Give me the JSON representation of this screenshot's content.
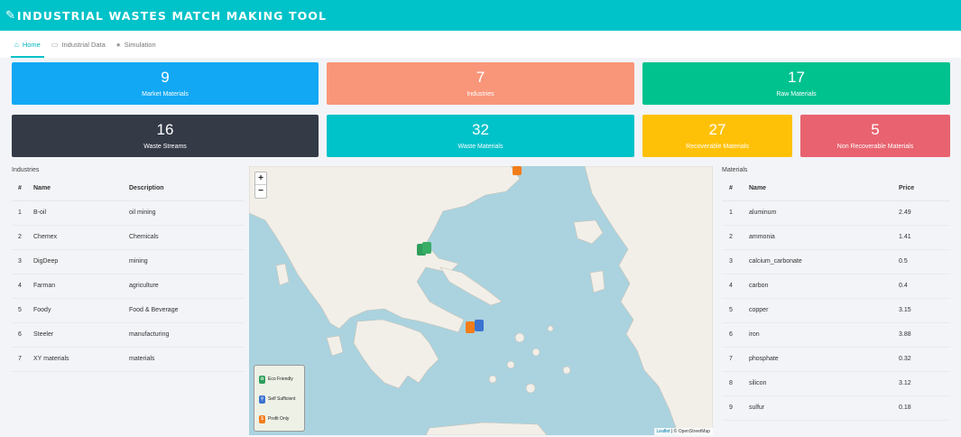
{
  "app": {
    "title": "INDUSTRIAL WASTES MATCH MAKING TOOL",
    "logo_icon": "pencil-square-icon"
  },
  "nav": {
    "tabs": [
      {
        "label": "Home",
        "icon": "home-icon",
        "active": true
      },
      {
        "label": "Industrial Data",
        "icon": "folder-icon",
        "active": false
      },
      {
        "label": "Simulation",
        "icon": "android-icon",
        "active": false
      }
    ]
  },
  "stats": [
    {
      "value": "9",
      "label": "Market Materials",
      "color": "#12a8f4"
    },
    {
      "value": "7",
      "label": "Industries",
      "color": "#f9967a"
    },
    {
      "value": "17",
      "label": "Raw Materials",
      "color": "#00c28f"
    },
    {
      "value": "16",
      "label": "Waste Streams",
      "color": "#343a46"
    },
    {
      "value": "32",
      "label": "Waste Materials",
      "color": "#00c2c9"
    },
    {
      "value": "27",
      "label": "Recoverable Materials",
      "color": "#ffc107"
    },
    {
      "value": "5",
      "label": "Non Recoverable Materials",
      "color": "#e8636f"
    }
  ],
  "industries": {
    "title": "Industries",
    "columns": [
      "#",
      "Name",
      "Description"
    ],
    "rows": [
      [
        "1",
        "B-oil",
        "oil mining"
      ],
      [
        "2",
        "Chemex",
        "Chemicals"
      ],
      [
        "3",
        "DigDeep",
        "mining"
      ],
      [
        "4",
        "Farman",
        "agriculture"
      ],
      [
        "5",
        "Foody",
        "Food & Beverage"
      ],
      [
        "6",
        "Steeler",
        "manufacturing"
      ],
      [
        "7",
        "XY materials",
        "materials"
      ]
    ]
  },
  "materials": {
    "title": "Materials",
    "columns": [
      "#",
      "Name",
      "Price"
    ],
    "rows": [
      [
        "1",
        "aluminum",
        "2.49"
      ],
      [
        "2",
        "ammonia",
        "1.41"
      ],
      [
        "3",
        "calcium_carbonate",
        "0.5"
      ],
      [
        "4",
        "carbon",
        "0.4"
      ],
      [
        "5",
        "copper",
        "3.15"
      ],
      [
        "6",
        "iron",
        "3.88"
      ],
      [
        "7",
        "phosphate",
        "0.32"
      ],
      [
        "8",
        "silicon",
        "3.12"
      ],
      [
        "9",
        "sulfur",
        "0.18"
      ]
    ]
  },
  "map": {
    "zoom_in": "+",
    "zoom_out": "−",
    "legend": [
      {
        "label": "Eco Friendly",
        "color": "#2e9e5b",
        "glyph": "♻"
      },
      {
        "label": "Self Sufficient",
        "color": "#3b73d1",
        "glyph": "⚲"
      },
      {
        "label": "Profit Only",
        "color": "#f27d1a",
        "glyph": "$"
      }
    ],
    "attribution_leaflet": "Leaflet",
    "attribution_rest": " | © OpenStreetMap",
    "water_color": "#aad3df",
    "land_color": "#f2efe9"
  }
}
